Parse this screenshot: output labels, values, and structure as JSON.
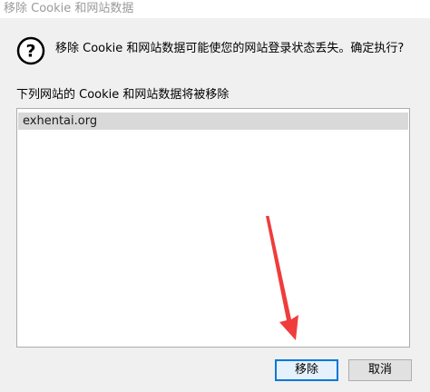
{
  "dialog": {
    "title": "移除 Cookie 和网站数据",
    "message": "移除 Cookie 和网站数据可能使您的网站登录状态丢失。确定执行?",
    "icon": "question-icon",
    "list_label": "下列网站的 Cookie 和网站数据将被移除",
    "sites": [
      "exhentai.org"
    ],
    "buttons": {
      "confirm_label": "移除",
      "cancel_label": "取消"
    }
  },
  "colors": {
    "accent": "#0078d7",
    "arrow": "#f03c3c",
    "selection": "#d9d9d9"
  }
}
